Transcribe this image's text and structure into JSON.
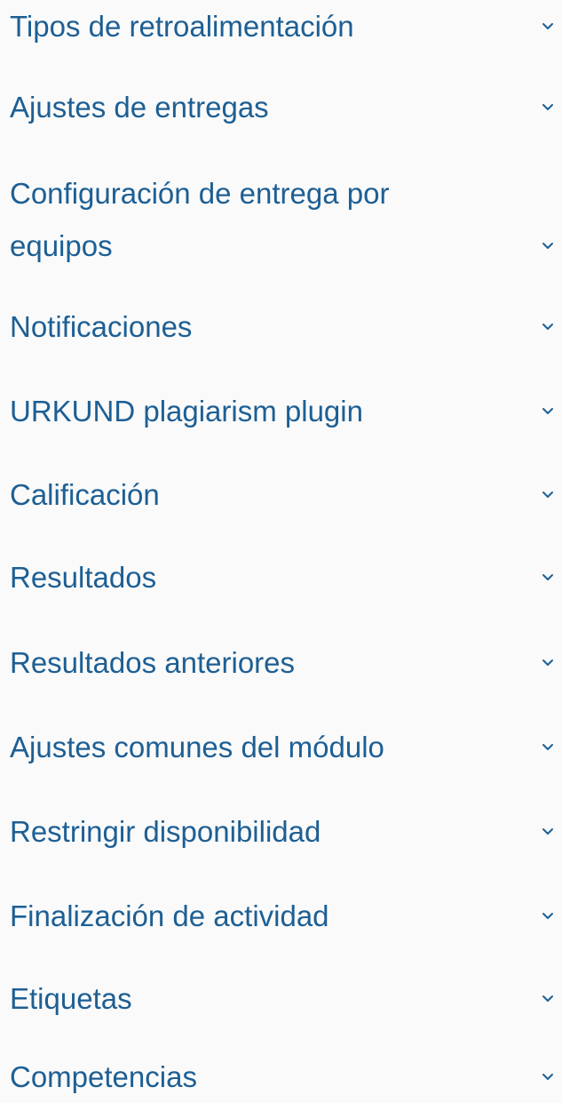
{
  "sections": [
    {
      "label": "Tipos de retroalimentación",
      "expanded": false,
      "icon": "chevron-down-icon"
    },
    {
      "label": "Ajustes de entregas",
      "expanded": false,
      "icon": "chevron-down-icon"
    },
    {
      "label_line1": "Configuración de entrega por",
      "label_line2": "equipos",
      "expanded": false,
      "icon": "chevron-down-icon"
    },
    {
      "label": "Notificaciones",
      "expanded": false,
      "icon": "chevron-down-icon"
    },
    {
      "label": "URKUND plagiarism plugin",
      "expanded": false,
      "icon": "chevron-down-icon"
    },
    {
      "label": "Calificación",
      "expanded": false,
      "icon": "chevron-down-icon"
    },
    {
      "label": "Resultados",
      "expanded": false,
      "icon": "chevron-down-icon"
    },
    {
      "label": "Resultados anteriores",
      "expanded": false,
      "icon": "chevron-down-icon"
    },
    {
      "label": "Ajustes comunes del módulo",
      "expanded": false,
      "icon": "chevron-down-icon"
    },
    {
      "label": "Restringir disponibilidad",
      "expanded": false,
      "icon": "chevron-down-icon"
    },
    {
      "label": "Finalización de actividad",
      "expanded": false,
      "icon": "chevron-down-icon"
    },
    {
      "label": "Etiquetas",
      "expanded": false,
      "icon": "chevron-down-icon"
    },
    {
      "label": "Competencias",
      "expanded": false,
      "icon": "chevron-down-icon"
    }
  ],
  "colors": {
    "link": "#1d5f94",
    "chevron": "#1d5f94",
    "background": "#fafafa"
  }
}
